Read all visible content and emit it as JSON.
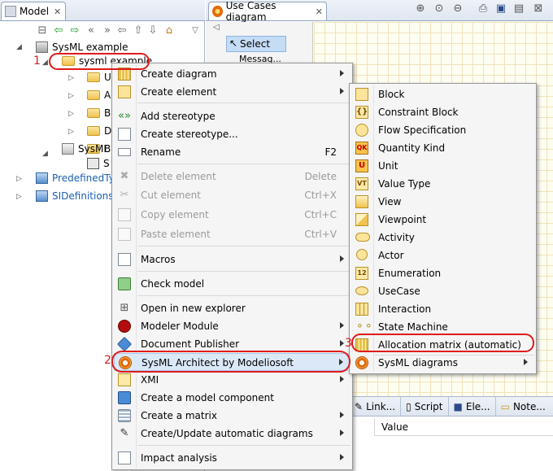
{
  "model_view": {
    "tab_label": "Model",
    "tree": {
      "root": "SysML example",
      "selected": "sysml example",
      "child_prefixes": [
        "U",
        "A",
        "B",
        "D",
        "B"
      ],
      "sysml_node": "SysML",
      "sysml_child_prefix": "S",
      "predefined": "PredefinedTy",
      "sidefinitions": "SIDefinitions"
    }
  },
  "diagram_view": {
    "tab_label": "Use Cases diagram",
    "palette": {
      "select_label": "Select",
      "next_item_partial": "Messag..."
    }
  },
  "bottom_view": {
    "tabs": [
      "Link...",
      "Script",
      "Ele...",
      "Note..."
    ],
    "column_header": "Value"
  },
  "context_menu": {
    "items": [
      {
        "label": "Create diagram",
        "submenu": true
      },
      {
        "label": "Create element",
        "submenu": true
      },
      {
        "label": "Add stereotype"
      },
      {
        "label": "Create stereotype..."
      },
      {
        "label": "Rename",
        "shortcut": "F2"
      },
      {
        "label": "Delete element",
        "shortcut": "Delete"
      },
      {
        "label": "Cut element",
        "shortcut": "Ctrl+X"
      },
      {
        "label": "Copy element",
        "shortcut": "Ctrl+C"
      },
      {
        "label": "Paste element",
        "shortcut": "Ctrl+V"
      },
      {
        "label": "Macros",
        "submenu": true
      },
      {
        "label": "Check model"
      },
      {
        "label": "Open in new explorer"
      },
      {
        "label": "Modeler Module",
        "submenu": true
      },
      {
        "label": "Document Publisher",
        "submenu": true
      },
      {
        "label": "SysML Architect by Modeliosoft",
        "submenu": true
      },
      {
        "label": "XMI",
        "submenu": true
      },
      {
        "label": "Create a model component"
      },
      {
        "label": "Create a matrix",
        "submenu": true
      },
      {
        "label": "Create/Update automatic diagrams",
        "submenu": true
      },
      {
        "label": "Impact analysis",
        "submenu": true
      }
    ]
  },
  "sub_menu": {
    "items": [
      {
        "label": "Block"
      },
      {
        "label": "Constraint Block"
      },
      {
        "label": "Flow Specification"
      },
      {
        "label": "Quantity Kind"
      },
      {
        "label": "Unit"
      },
      {
        "label": "Value Type"
      },
      {
        "label": "View"
      },
      {
        "label": "Viewpoint"
      },
      {
        "label": "Activity"
      },
      {
        "label": "Actor"
      },
      {
        "label": "Enumeration"
      },
      {
        "label": "UseCase"
      },
      {
        "label": "Interaction"
      },
      {
        "label": "State Machine"
      },
      {
        "label": "Allocation matrix (automatic)"
      },
      {
        "label": "SysML diagrams",
        "submenu": true
      }
    ]
  },
  "icon_text": {
    "qk": "QK",
    "u": "U",
    "vt": "VT",
    "enum": "12"
  },
  "callouts": {
    "step1": "1",
    "step2": "2",
    "step3": "3",
    "color": "#e01b1b"
  }
}
